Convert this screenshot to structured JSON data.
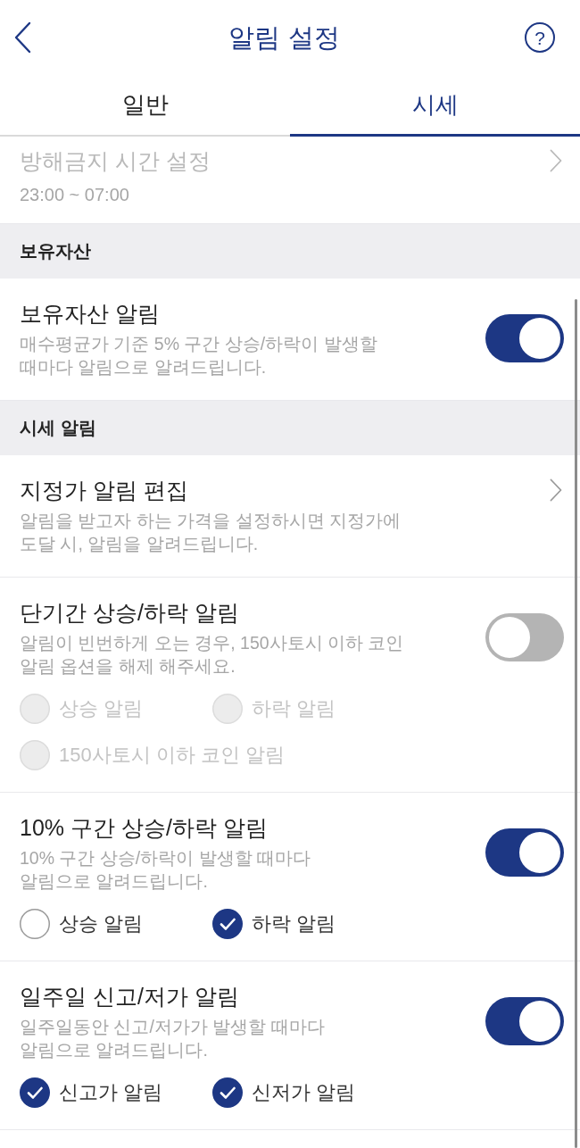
{
  "header": {
    "title": "알림 설정",
    "help_label": "?"
  },
  "tabs": [
    {
      "label": "일반",
      "selected": false
    },
    {
      "label": "시세",
      "selected": true
    }
  ],
  "sections": [
    {
      "rows": [
        {
          "kind": "link",
          "title": "방해금지 시간 설정",
          "value": "23:00 ~ 07:00",
          "disabled": true
        }
      ]
    },
    {
      "heading": "보유자산",
      "rows": [
        {
          "kind": "toggle",
          "title": "보유자산 알림",
          "description": "매수평균가 기준 5% 구간 상승/하락이 발생할\n때마다 알림으로 알려드립니다.",
          "on": true,
          "disabled": false
        }
      ]
    },
    {
      "heading": "시세 알림",
      "rows": [
        {
          "kind": "link",
          "title": "지정가 알림 편집",
          "description": "알림을 받고자 하는 가격을 설정하시면 지정가에\n도달 시, 알림을 알려드립니다.",
          "disabled": false
        },
        {
          "kind": "toggle",
          "title": "단기간 상승/하락 알림",
          "description": "알림이 빈번하게 오는 경우, 150사토시 이하 코인\n알림 옵션을 해제 해주세요.",
          "on": false,
          "disabled": false,
          "options": [
            {
              "label": "상승 알림",
              "checked": false,
              "disabled": true
            },
            {
              "label": "하락 알림",
              "checked": false,
              "disabled": true
            },
            {
              "label": "150사토시 이하 코인 알림",
              "checked": false,
              "disabled": true
            }
          ]
        },
        {
          "kind": "toggle",
          "title": "10% 구간 상승/하락 알림",
          "description": "10% 구간 상승/하락이 발생할 때마다\n알림으로 알려드립니다.",
          "on": true,
          "disabled": false,
          "options": [
            {
              "label": "상승 알림",
              "checked": false,
              "disabled": false
            },
            {
              "label": "하락 알림",
              "checked": true,
              "disabled": false
            }
          ]
        },
        {
          "kind": "toggle",
          "title": "일주일 신고/저가 알림",
          "description": "일주일동안 신고/저가가 발생할 때마다\n알림으로 알려드립니다.",
          "on": true,
          "disabled": false,
          "options": [
            {
              "label": "신고가 알림",
              "checked": true,
              "disabled": false
            },
            {
              "label": "신저가 알림",
              "checked": true,
              "disabled": false
            }
          ]
        }
      ]
    }
  ]
}
